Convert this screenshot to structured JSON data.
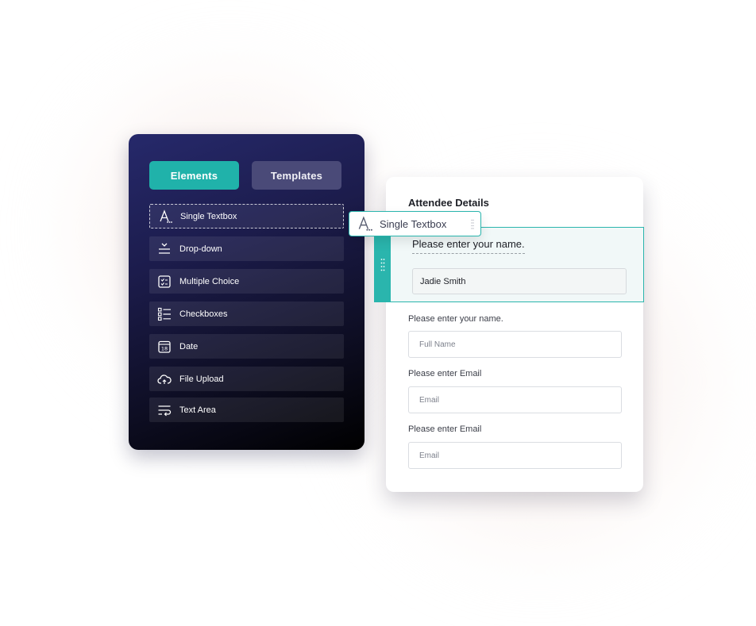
{
  "sidebar": {
    "tabs": {
      "elements": "Elements",
      "templates": "Templates"
    },
    "items": [
      {
        "label": "Single Textbox",
        "icon": "text-a-icon"
      },
      {
        "label": "Drop-down",
        "icon": "dropdown-icon"
      },
      {
        "label": "Multiple Choice",
        "icon": "multiple-choice-icon"
      },
      {
        "label": "Checkboxes",
        "icon": "checkbox-list-icon"
      },
      {
        "label": "Date",
        "icon": "calendar-icon"
      },
      {
        "label": "File Upload",
        "icon": "cloud-upload-icon"
      },
      {
        "label": "Text Area",
        "icon": "text-wrap-icon"
      }
    ]
  },
  "drag_chip": {
    "label": "Single Textbox",
    "icon": "text-a-icon"
  },
  "form": {
    "title": "Attendee Details",
    "active_field": {
      "label": "Please enter your name.",
      "value": "Jadie Smith"
    },
    "fields": [
      {
        "label": "Please enter your name.",
        "placeholder": "Full Name"
      },
      {
        "label": "Please enter Email",
        "placeholder": "Email"
      },
      {
        "label": "Please enter Email",
        "placeholder": "Email"
      }
    ]
  },
  "colors": {
    "accent": "#20b2aa",
    "panel_top": "#26296b",
    "panel_bottom": "#000000",
    "template_tab": "#4a4a78"
  }
}
